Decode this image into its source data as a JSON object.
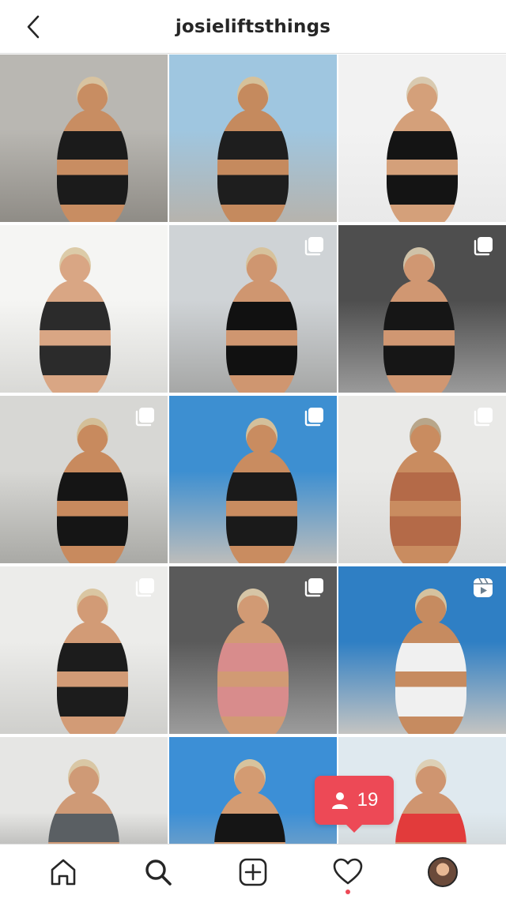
{
  "header": {
    "title": "josieliftsthings",
    "back_icon": "chevron-left-icon"
  },
  "grid": {
    "tiles": [
      {
        "alt": "",
        "type": "photo",
        "bg": [
          "#b9b7b2",
          "#8f8c86"
        ],
        "skin": "#c88d62",
        "outfit": "#1b1b1b",
        "hair": "#d8c3a0"
      },
      {
        "alt": "",
        "type": "photo",
        "bg": [
          "#9fc6e0",
          "#b6b3ad"
        ],
        "skin": "#c58a5e",
        "outfit": "#1e1e1e",
        "hair": "#d6c19a"
      },
      {
        "alt": "",
        "type": "photo",
        "bg": [
          "#f2f2f2",
          "#e9e9e9"
        ],
        "skin": "#d4a07a",
        "outfit": "#141414",
        "hair": "#d9cab0"
      },
      {
        "alt": "",
        "type": "photo",
        "bg": [
          "#f5f5f3",
          "#d9d9d6"
        ],
        "skin": "#d9a684",
        "outfit": "#2b2b2b",
        "hair": "#dccba8"
      },
      {
        "alt": "",
        "type": "multi",
        "bg": [
          "#cfd3d6",
          "#a6a7a6"
        ],
        "skin": "#cf9670",
        "outfit": "#111111",
        "hair": "#d7c29c"
      },
      {
        "alt": "",
        "type": "multi",
        "bg": [
          "#4e4e4e",
          "#9a9a9a"
        ],
        "skin": "#d09772",
        "outfit": "#161616",
        "hair": "#cfc2a8"
      },
      {
        "alt": "",
        "type": "multi",
        "bg": [
          "#d7d7d4",
          "#a9a9a5"
        ],
        "skin": "#c88a5e",
        "outfit": "#151515",
        "hair": "#d4bf98"
      },
      {
        "alt": "",
        "type": "multi",
        "bg": [
          "#3d8fd1",
          "#bdbdbb"
        ],
        "skin": "#c98c60",
        "outfit": "#1a1a1a",
        "hair": "#d4c09b"
      },
      {
        "alt": "",
        "type": "multi",
        "bg": [
          "#e9e9e7",
          "#d8d8d6"
        ],
        "skin": "#c98c60",
        "outfit": "#b46a48",
        "hair": "#b8a68a"
      },
      {
        "alt": "",
        "type": "multi",
        "bg": [
          "#ececea",
          "#cfcfcc"
        ],
        "skin": "#d29b76",
        "outfit": "#1c1c1c",
        "hair": "#dac6a2"
      },
      {
        "alt": "",
        "type": "multi",
        "bg": [
          "#5a5a5a",
          "#9c9c9c"
        ],
        "skin": "#d19a74",
        "outfit": "#d88c8c",
        "hair": "#d6c5a6"
      },
      {
        "alt": "",
        "type": "reel",
        "bg": [
          "#2f7fc4",
          "#c4c4c2"
        ],
        "skin": "#c68b60",
        "outfit": "#f0f0f0",
        "hair": "#d5c29f"
      },
      {
        "alt": "",
        "type": "photo",
        "bg": [
          "#e6e6e4",
          "#7a7a78"
        ],
        "skin": "#cf9a76",
        "outfit": "#5a5f63",
        "hair": "#d9c7a5"
      },
      {
        "alt": "",
        "type": "photo",
        "bg": [
          "#3c8fd6",
          "#b8b8b6"
        ],
        "skin": "#d39b72",
        "outfit": "#151515",
        "hair": "#d7c39d"
      },
      {
        "alt": "",
        "type": "photo",
        "bg": [
          "#dfe9ef",
          "#bdbdbb"
        ],
        "skin": "#cf9570",
        "outfit": "#e23b3b",
        "hair": "#ddd0b6"
      }
    ]
  },
  "activity_badge": {
    "icon": "person-icon",
    "count": "19",
    "color": "#ed4956"
  },
  "bottom_nav": {
    "items": [
      {
        "name": "home",
        "icon": "home-icon"
      },
      {
        "name": "search",
        "icon": "search-icon"
      },
      {
        "name": "new-post",
        "icon": "plus-square-icon"
      },
      {
        "name": "activity",
        "icon": "heart-icon"
      },
      {
        "name": "profile",
        "icon": "avatar"
      }
    ]
  }
}
